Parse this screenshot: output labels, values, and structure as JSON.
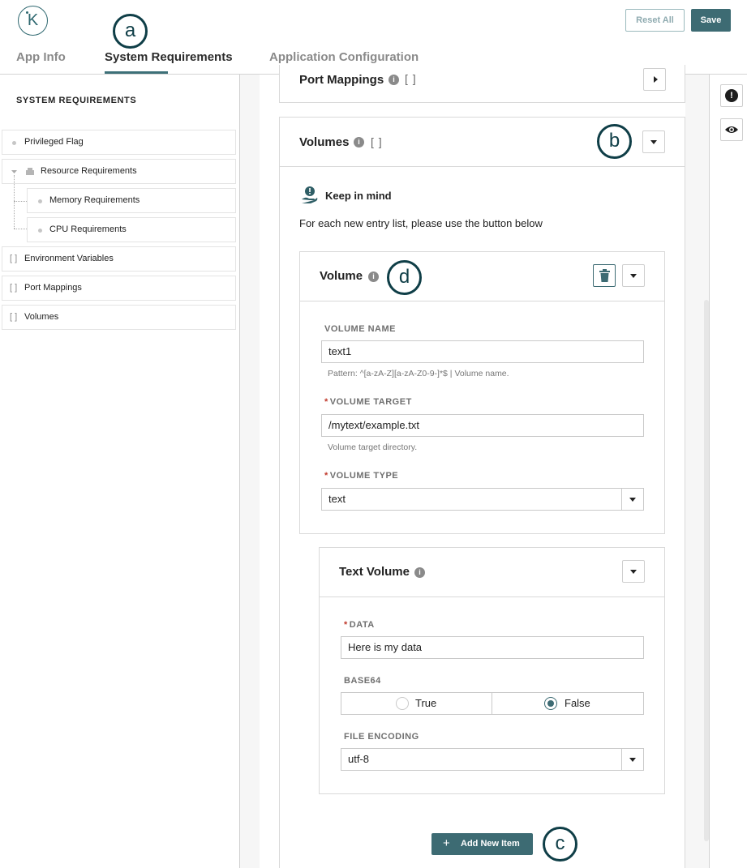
{
  "header": {
    "logo_letter": "K",
    "tabs": [
      {
        "label": "App Info",
        "active": false
      },
      {
        "label": "System Requirements",
        "active": true
      },
      {
        "label": "Application Configuration",
        "active": false
      }
    ],
    "reset_label": "Reset All",
    "save_label": "Save"
  },
  "callouts": {
    "a": "a",
    "b": "b",
    "c": "c",
    "d": "d"
  },
  "sidebar": {
    "title": "SYSTEM REQUIREMENTS",
    "items": [
      {
        "label": "Privileged Flag"
      },
      {
        "label": "Resource Requirements"
      },
      {
        "label": "Memory Requirements"
      },
      {
        "label": "CPU Requirements"
      },
      {
        "label": "Environment Variables",
        "bracket": "[ ]"
      },
      {
        "label": "Port Mappings",
        "bracket": "[ ]"
      },
      {
        "label": "Volumes",
        "bracket": "[ ]"
      }
    ]
  },
  "port_mappings": {
    "title": "Port Mappings",
    "brackets": "[ ]"
  },
  "volumes": {
    "title": "Volumes",
    "brackets": "[ ]",
    "keep_in_mind": "Keep in mind",
    "instruction": "For each new entry list, please use the button below",
    "volume": {
      "title": "Volume",
      "name_label": "VOLUME NAME",
      "name_value": "text1",
      "name_hint": "Pattern: ^[a-zA-Z][a-zA-Z0-9-]*$ | Volume name.",
      "target_label": "VOLUME TARGET",
      "target_value": "/mytext/example.txt",
      "target_hint": "Volume target directory.",
      "type_label": "VOLUME TYPE",
      "type_value": "text"
    },
    "text_volume": {
      "title": "Text Volume",
      "data_label": "DATA",
      "data_value": "Here is my data",
      "base64_label": "BASE64",
      "base64_options": [
        "True",
        "False"
      ],
      "base64_selected": "False",
      "encoding_label": "FILE ENCODING",
      "encoding_value": "utf-8"
    },
    "add_label": "Add New Item"
  },
  "icons": {
    "required_marker": "*",
    "info": "i",
    "add": "+",
    "alert": "!"
  }
}
